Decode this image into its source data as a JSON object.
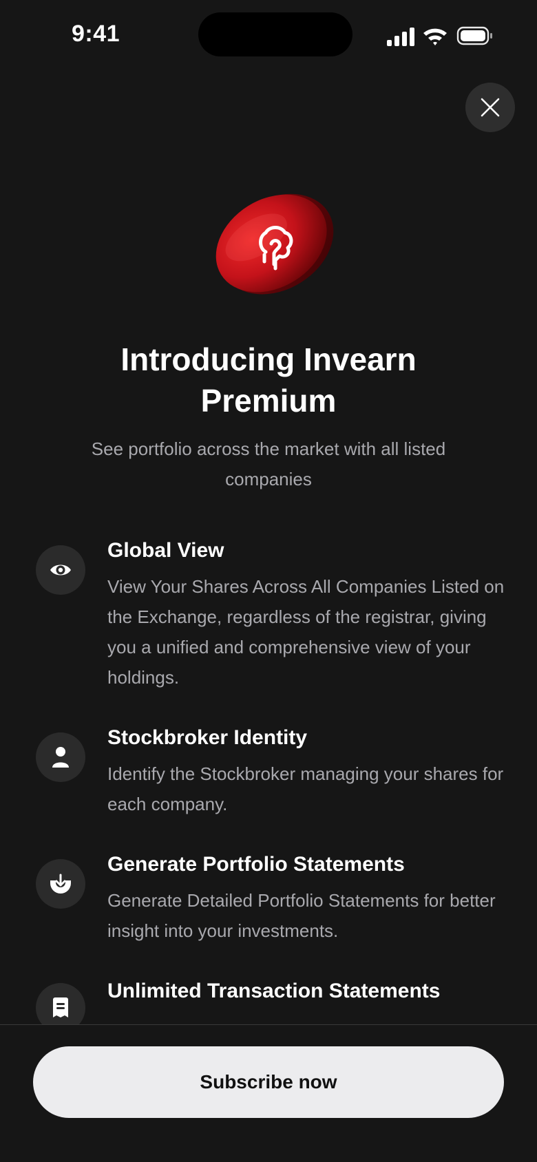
{
  "status_bar": {
    "time": "9:41",
    "icons": [
      "cellular-signal-icon",
      "wifi-icon",
      "battery-icon"
    ]
  },
  "close_button": {
    "icon": "close-icon"
  },
  "hero": {
    "icon": "invearn-logo-coin",
    "title": "Introducing Invearn Premium",
    "subtitle": "See portfolio across the market with all listed companies"
  },
  "features": [
    {
      "icon": "eye-icon",
      "title": "Global View",
      "description": "View Your Shares Across All Companies Listed on the Exchange, regardless of the registrar, giving you a unified and comprehensive view of your holdings."
    },
    {
      "icon": "user-icon",
      "title": "Stockbroker Identity",
      "description": "Identify the Stockbroker managing your shares for each company."
    },
    {
      "icon": "download-tray-icon",
      "title": "Generate Portfolio Statements",
      "description": "Generate Detailed Portfolio Statements for better insight into your investments."
    },
    {
      "icon": "receipt-icon",
      "title": "Unlimited Transaction Statements",
      "description": ""
    }
  ],
  "footer": {
    "cta_label": "Subscribe now"
  },
  "colors": {
    "background": "#161616",
    "accent": "#d0161c",
    "button_bg": "#ececee",
    "secondary_text": "#a9a9ae",
    "icon_circle": "#2b2b2b"
  }
}
